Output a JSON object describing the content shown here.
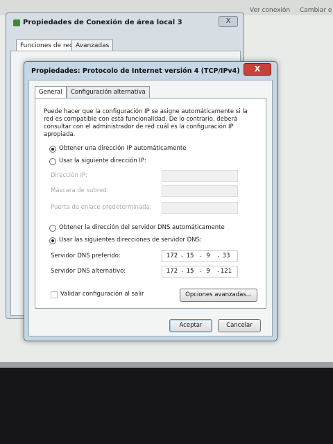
{
  "background": {
    "topbar_items": [
      "Ver conexión",
      "Cambiar e"
    ],
    "back_window": {
      "title": "Propiedades de Conexión de área local 3",
      "close": "X",
      "tabs": [
        "Funciones de red",
        "Avanzadas"
      ]
    }
  },
  "dialog": {
    "title": "Propiedades: Protocolo de Internet versión 4 (TCP/IPv4)",
    "close": "X",
    "tabs": [
      "General",
      "Configuración alternativa"
    ],
    "intro": [
      "Puede hacer que la configuración IP se asigne automáticamente si la",
      "red es compatible con esta funcionalidad. De lo contrario, deberá",
      "consultar con el administrador de red cuál es la configuración IP",
      "apropiada."
    ],
    "ip": {
      "auto_label": "Obtener una dirección IP automáticamente",
      "manual_label": "Usar la siguiente dirección IP:",
      "auto_selected": true,
      "address_label": "Dirección IP:",
      "mask_label": "Máscara de subred:",
      "gateway_label": "Puerta de enlace predeterminada:"
    },
    "dns": {
      "auto_label": "Obtener la dirección del servidor DNS automáticamente",
      "manual_label": "Usar las siguientes direcciones de servidor DNS:",
      "manual_selected": true,
      "preferred_label": "Servidor DNS preferido:",
      "alternate_label": "Servidor DNS alternativo:",
      "preferred": [
        "172",
        "15",
        "9",
        "33"
      ],
      "alternate": [
        "172",
        "15",
        "9",
        "121"
      ]
    },
    "validate_label": "Validar configuración al salir",
    "advanced_button": "Opciones avanzadas...",
    "ok_button": "Aceptar",
    "cancel_button": "Cancelar"
  }
}
